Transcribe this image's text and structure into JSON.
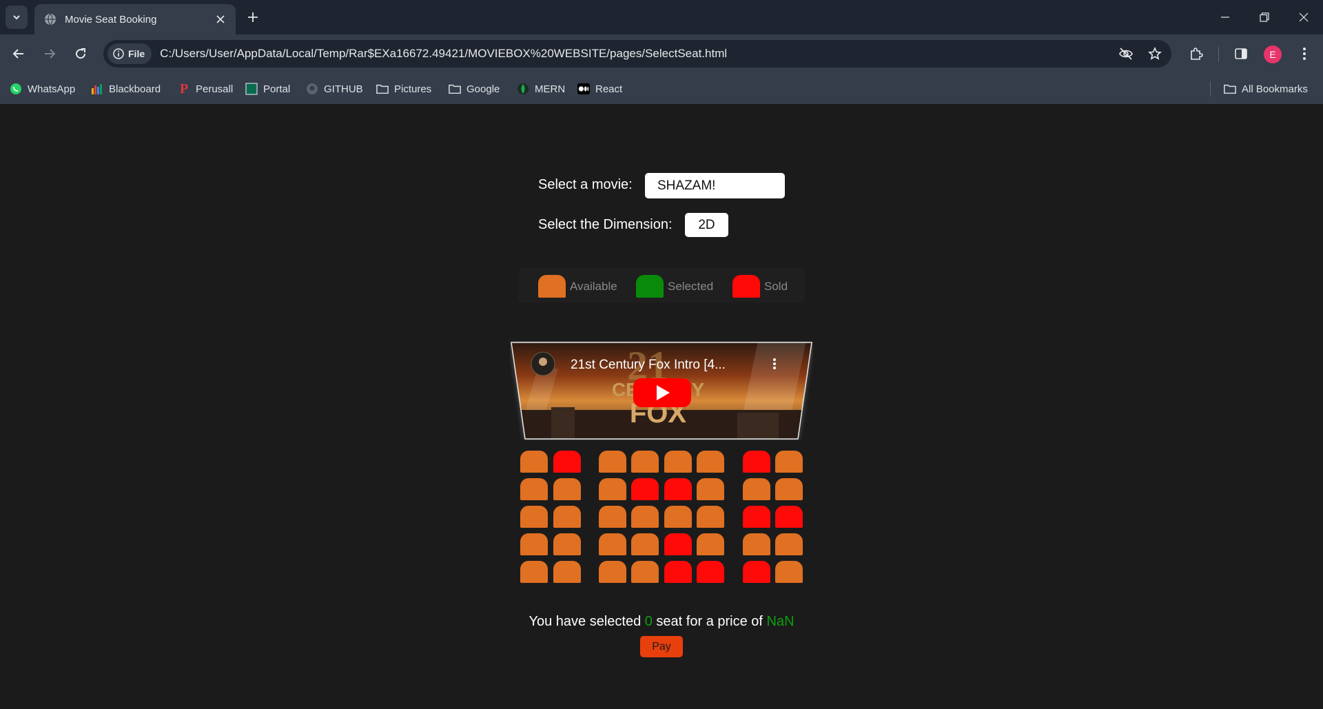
{
  "browser": {
    "tab_title": "Movie Seat Booking",
    "file_label": "File",
    "url": "C:/Users/User/AppData/Local/Temp/Rar$EXa16672.49421/MOVIEBOX%20WEBSITE/pages/SelectSeat.html",
    "profile_initial": "E",
    "bookmarks": [
      {
        "label": "WhatsApp",
        "icon": "whatsapp-icon"
      },
      {
        "label": "Blackboard",
        "icon": "blackboard-icon"
      },
      {
        "label": "Perusall",
        "icon": "perusall-icon"
      },
      {
        "label": "Portal",
        "icon": "portal-icon"
      },
      {
        "label": "GITHUB",
        "icon": "github-icon"
      },
      {
        "label": "Pictures",
        "icon": "folder-icon"
      },
      {
        "label": "Google",
        "icon": "folder-icon"
      },
      {
        "label": "MERN",
        "icon": "mongodb-icon"
      },
      {
        "label": "React",
        "icon": "medium-icon"
      }
    ],
    "all_bookmarks": "All Bookmarks"
  },
  "form": {
    "movie_label": "Select a movie:",
    "movie_value": "SHAZAM!",
    "dimension_label": "Select the Dimension:",
    "dimension_value": "2D"
  },
  "legend": {
    "available": "Available",
    "selected": "Selected",
    "sold": "Sold"
  },
  "colors": {
    "available": "#e07022",
    "selected": "#0a8a0a",
    "sold": "#ff0909",
    "pay_button": "#e8400c"
  },
  "video": {
    "title": "21st Century Fox Intro [4...",
    "logo_line1": "CENTURY",
    "logo_line2": "FOX"
  },
  "seats": [
    [
      "available",
      "sold",
      "available",
      "available",
      "available",
      "available",
      "sold",
      "available"
    ],
    [
      "available",
      "available",
      "available",
      "sold",
      "sold",
      "available",
      "available",
      "available"
    ],
    [
      "available",
      "available",
      "available",
      "available",
      "available",
      "available",
      "sold",
      "sold"
    ],
    [
      "available",
      "available",
      "available",
      "available",
      "sold",
      "available",
      "available",
      "available"
    ],
    [
      "available",
      "available",
      "available",
      "available",
      "sold",
      "sold",
      "sold",
      "available"
    ]
  ],
  "summary": {
    "prefix": "You have selected ",
    "count": "0",
    "middle": " seat for a price of ",
    "price": "NaN"
  },
  "pay_label": "Pay"
}
